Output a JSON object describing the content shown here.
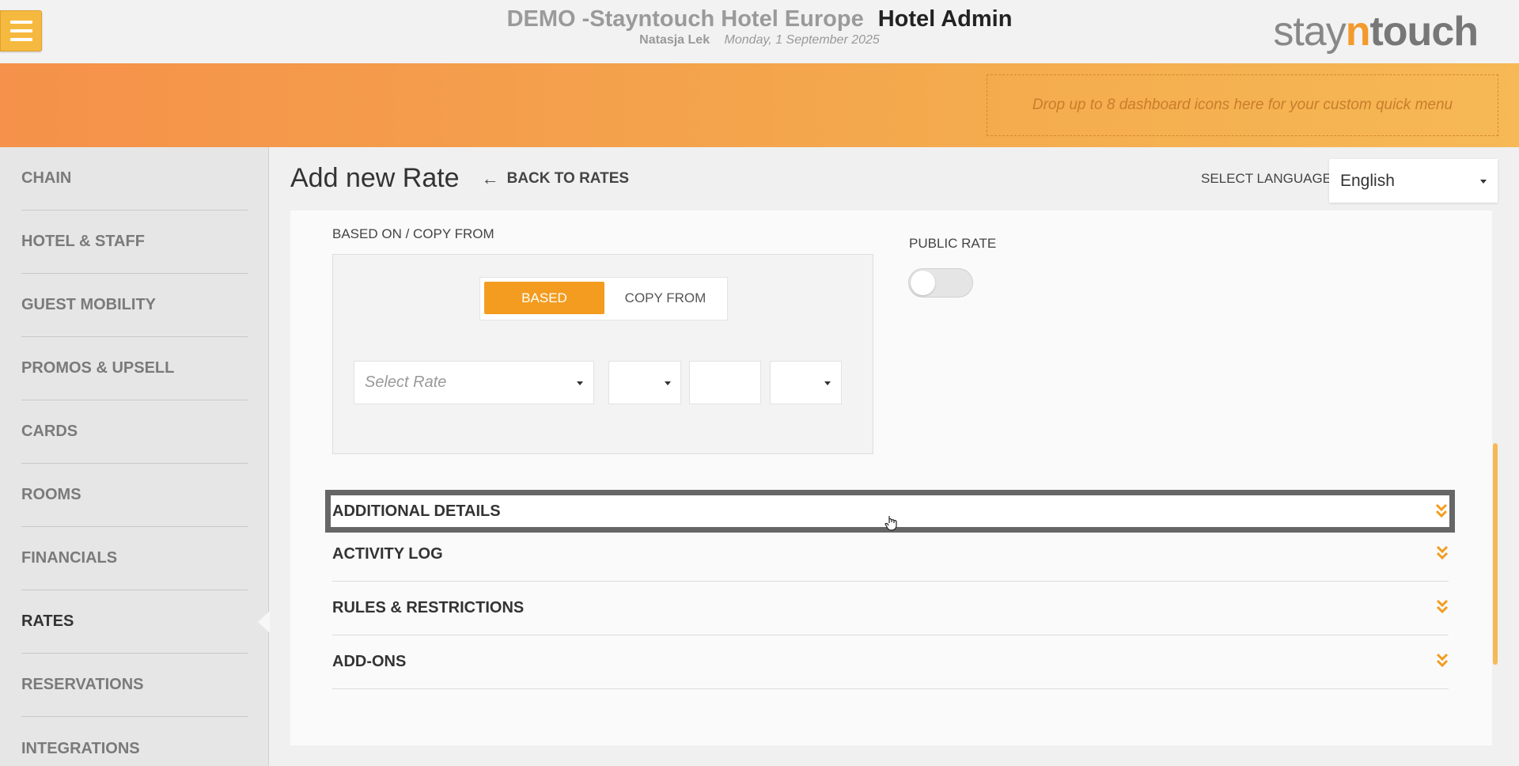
{
  "header": {
    "hotel_name": "DEMO -Stayntouch Hotel Europe",
    "app_name": "Hotel Admin",
    "user_name": "Natasja Lek",
    "date": "Monday, 1 September 2025",
    "brand": {
      "pre": "stay",
      "n": "n",
      "post": "touch"
    }
  },
  "quickbar": {
    "dropzone_text": "Drop up to 8 dashboard icons here for your custom quick menu"
  },
  "sidebar": {
    "items": [
      {
        "label": "CHAIN",
        "active": false
      },
      {
        "label": "HOTEL & STAFF",
        "active": false
      },
      {
        "label": "GUEST MOBILITY",
        "active": false
      },
      {
        "label": "PROMOS & UPSELL",
        "active": false
      },
      {
        "label": "CARDS",
        "active": false
      },
      {
        "label": "ROOMS",
        "active": false
      },
      {
        "label": "FINANCIALS",
        "active": false
      },
      {
        "label": "RATES",
        "active": true
      },
      {
        "label": "RESERVATIONS",
        "active": false
      },
      {
        "label": "INTEGRATIONS",
        "active": false
      }
    ]
  },
  "page": {
    "title": "Add new Rate",
    "back_label": "BACK TO RATES",
    "language_label": "SELECT LANGUAGE",
    "language_value": "English"
  },
  "form": {
    "based_on_label": "BASED ON / COPY FROM",
    "seg_based": "BASED",
    "seg_copy_from": "COPY FROM",
    "select_rate_placeholder": "Select Rate",
    "public_rate_label": "PUBLIC RATE",
    "public_rate_on": false
  },
  "accordions": [
    {
      "label": "ADDITIONAL DETAILS",
      "focused": true
    },
    {
      "label": "ACTIVITY LOG",
      "focused": false
    },
    {
      "label": "RULES & RESTRICTIONS",
      "focused": false
    },
    {
      "label": "ADD-ONS",
      "focused": false
    }
  ],
  "colors": {
    "accent": "#f39c1f",
    "header_gradient_start": "#f5914a",
    "header_gradient_end": "#f6b955"
  }
}
